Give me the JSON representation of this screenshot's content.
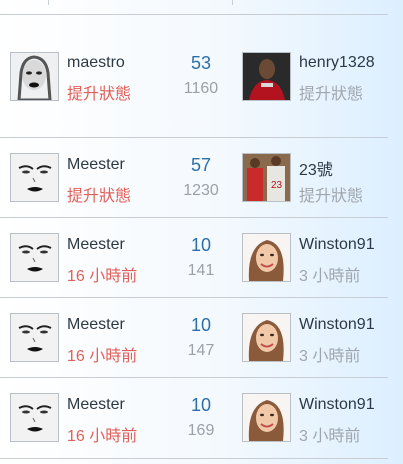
{
  "rows": [
    {
      "left": {
        "name": "maestro",
        "meta": "提升狀態",
        "avatar": "woman-portrait-avatar"
      },
      "count": "53",
      "total": "1160",
      "right": {
        "name": "henry1328",
        "meta": "提升狀態",
        "avatar": "soccer-player-avatar"
      }
    },
    {
      "left": {
        "name": "Meester",
        "meta": "提升狀態",
        "avatar": "face-sketch-avatar"
      },
      "count": "57",
      "total": "1230",
      "right": {
        "name": "23號",
        "meta": "提升狀態",
        "avatar": "basketball-players-avatar"
      }
    },
    {
      "left": {
        "name": "Meester",
        "meta": "16 小時前",
        "avatar": "face-sketch-avatar"
      },
      "count": "10",
      "total": "141",
      "right": {
        "name": "Winston91",
        "meta": "3 小時前",
        "avatar": "girl-portrait-avatar"
      }
    },
    {
      "left": {
        "name": "Meester",
        "meta": "16 小時前",
        "avatar": "face-sketch-avatar"
      },
      "count": "10",
      "total": "147",
      "right": {
        "name": "Winston91",
        "meta": "3 小時前",
        "avatar": "girl-portrait-avatar"
      }
    },
    {
      "left": {
        "name": "Meester",
        "meta": "16 小時前",
        "avatar": "face-sketch-avatar"
      },
      "count": "10",
      "total": "169",
      "right": {
        "name": "Winston91",
        "meta": "3 小時前",
        "avatar": "girl-portrait-avatar"
      }
    }
  ],
  "colors": {
    "accent": "#e0605a",
    "count": "#2c6fa6",
    "muted": "#a0a6ad"
  }
}
